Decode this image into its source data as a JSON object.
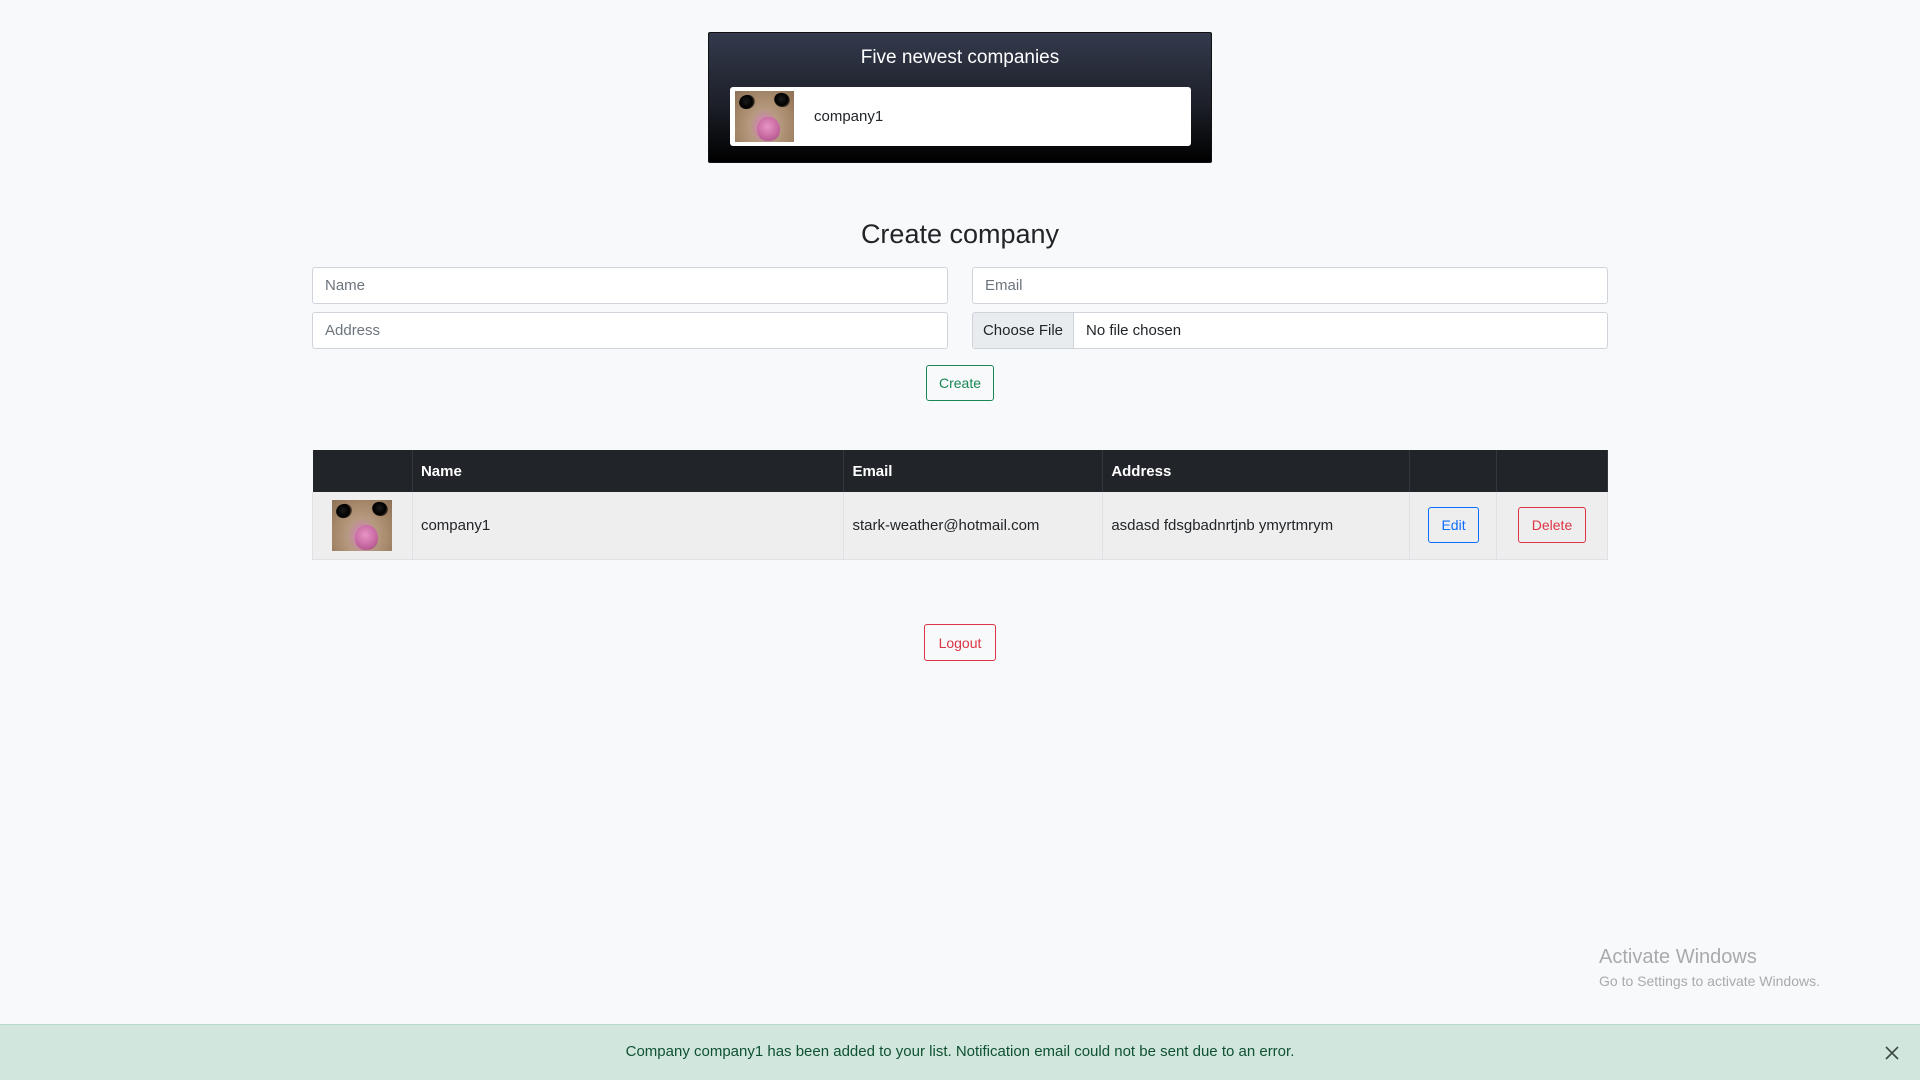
{
  "newest": {
    "title": "Five newest companies",
    "items": [
      {
        "name": "company1",
        "logo_icon": "cat-thumbnail"
      }
    ]
  },
  "form": {
    "title": "Create company",
    "name_placeholder": "Name",
    "email_placeholder": "Email",
    "address_placeholder": "Address",
    "file_button_label": "Choose File",
    "file_status": "No file chosen",
    "create_label": "Create"
  },
  "table": {
    "headers": [
      "",
      "Name",
      "Email",
      "Address",
      "",
      ""
    ],
    "rows": [
      {
        "logo_icon": "cat-thumbnail",
        "name": "company1",
        "email": "stark-weather@hotmail.com",
        "address": "asdasd fdsgbadnrtjnb ymyrtmrym",
        "edit_label": "Edit",
        "delete_label": "Delete"
      }
    ]
  },
  "logout_label": "Logout",
  "watermark": {
    "title": "Activate Windows",
    "subtitle": "Go to Settings to activate Windows."
  },
  "alert": {
    "message": "Company company1 has been added to your list. Notification email could not be sent due to an error.",
    "close_icon": "close-icon"
  },
  "colors": {
    "success": "#198754",
    "primary": "#0d6efd",
    "danger": "#dc3545",
    "alert_bg": "#d1e7dd",
    "table_header": "#212529"
  }
}
